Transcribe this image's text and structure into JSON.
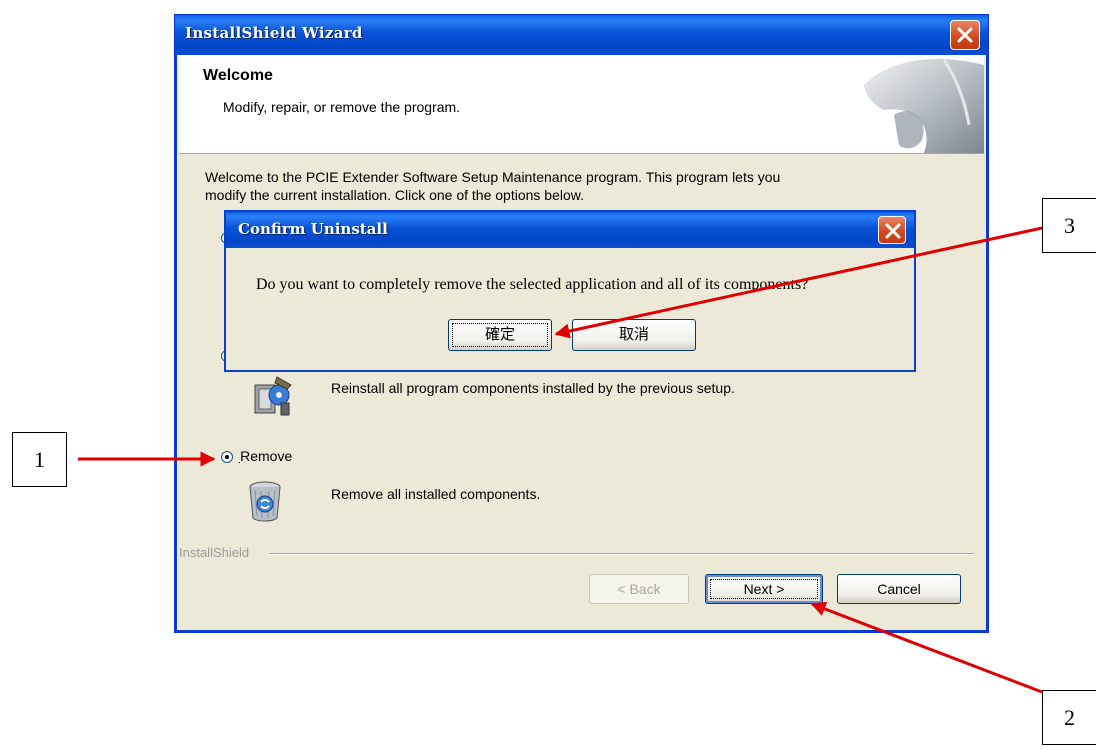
{
  "main_window": {
    "title": "InstallShield Wizard",
    "header_title": "Welcome",
    "header_subtitle": "Modify, repair, or remove the program.",
    "intro_line1": "Welcome to the PCIE Extender Software Setup Maintenance program. This program lets you",
    "intro_line2": "modify the current installation. Click one of the options below.",
    "repair_description": "Reinstall all program components installed by the previous setup.",
    "remove_label": "Remove",
    "remove_description": "Remove all installed components.",
    "frame_label": "InstallShield",
    "back_button": "< Back",
    "next_button": "Next >",
    "cancel_button": "Cancel"
  },
  "confirm_dialog": {
    "title": "Confirm Uninstall",
    "message": "Do you want to completely remove the selected application and all of its components?",
    "ok_button": "確定",
    "cancel_button": "取消"
  },
  "annotations": {
    "step1": "1",
    "step2": "2",
    "step3": "3",
    "arrow_color": "#e00000"
  },
  "icons": {
    "close": "close-icon",
    "repair": "repair-icon",
    "remove": "recycle-bin-icon"
  },
  "selected_option": "Remove"
}
